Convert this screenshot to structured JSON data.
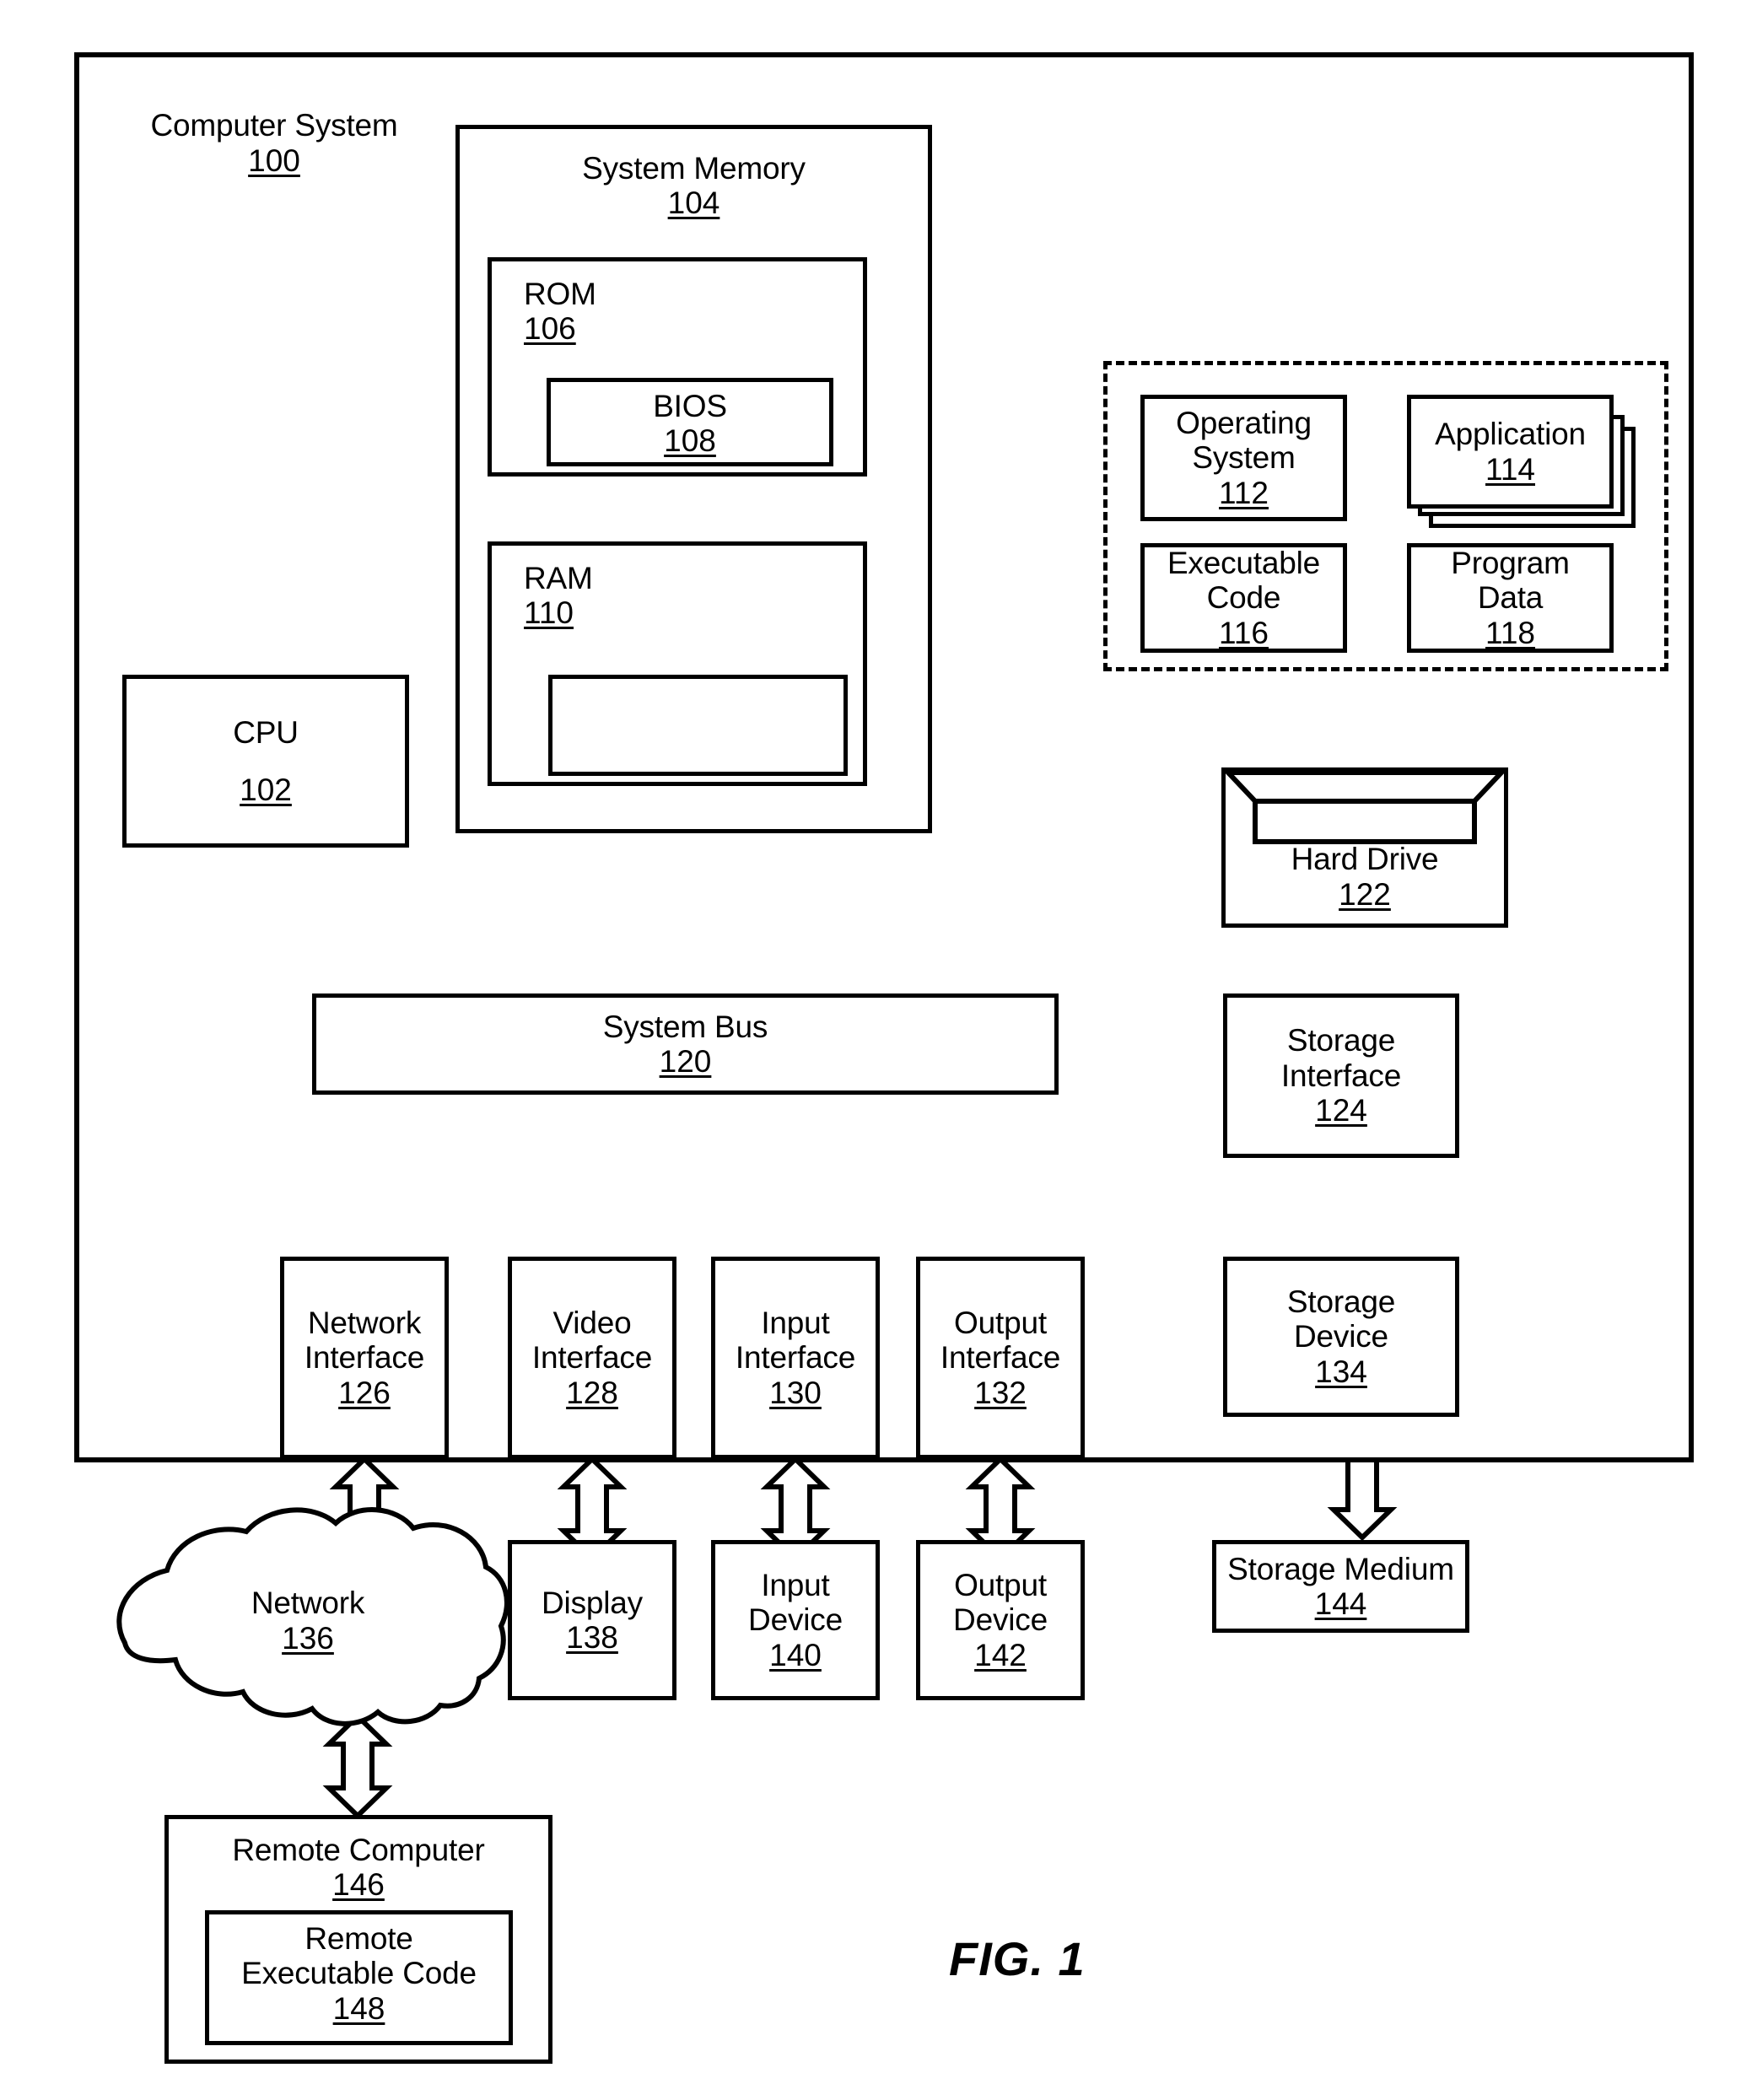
{
  "figure": {
    "caption": "FIG. 1"
  },
  "system": {
    "title": "Computer System",
    "number": "100"
  },
  "memory": {
    "title": "System Memory",
    "number": "104",
    "rom": {
      "title": "ROM",
      "number": "106"
    },
    "bios": {
      "title": "BIOS",
      "number": "108"
    },
    "ram": {
      "title": "RAM",
      "number": "110"
    }
  },
  "callout": {
    "operating_system": {
      "title": "Operating\nSystem",
      "number": "112"
    },
    "application": {
      "title": "Application",
      "number": "114"
    },
    "executable_code": {
      "title": "Executable\nCode",
      "number": "116"
    },
    "program_data": {
      "title": "Program\nData",
      "number": "118"
    }
  },
  "cpu": {
    "title": "CPU",
    "number": "102"
  },
  "bus": {
    "title": "System Bus",
    "number": "120"
  },
  "hard_drive": {
    "title": "Hard Drive",
    "number": "122"
  },
  "storage_interface": {
    "title": "Storage\nInterface",
    "number": "124"
  },
  "storage_device": {
    "title": "Storage\nDevice",
    "number": "134"
  },
  "storage_medium": {
    "title": "Storage Medium",
    "number": "144"
  },
  "interfaces": [
    {
      "title": "Network\nInterface",
      "number": "126"
    },
    {
      "title": "Video\nInterface",
      "number": "128"
    },
    {
      "title": "Input\nInterface",
      "number": "130"
    },
    {
      "title": "Output\nInterface",
      "number": "132"
    }
  ],
  "peripherals": [
    {
      "title": "Display",
      "number": "138"
    },
    {
      "title": "Input\nDevice",
      "number": "140"
    },
    {
      "title": "Output\nDevice",
      "number": "142"
    }
  ],
  "network": {
    "title": "Network",
    "number": "136"
  },
  "remote": {
    "computer": {
      "title": "Remote Computer",
      "number": "146"
    },
    "code": {
      "title": "Remote\nExecutable Code",
      "number": "148"
    }
  }
}
